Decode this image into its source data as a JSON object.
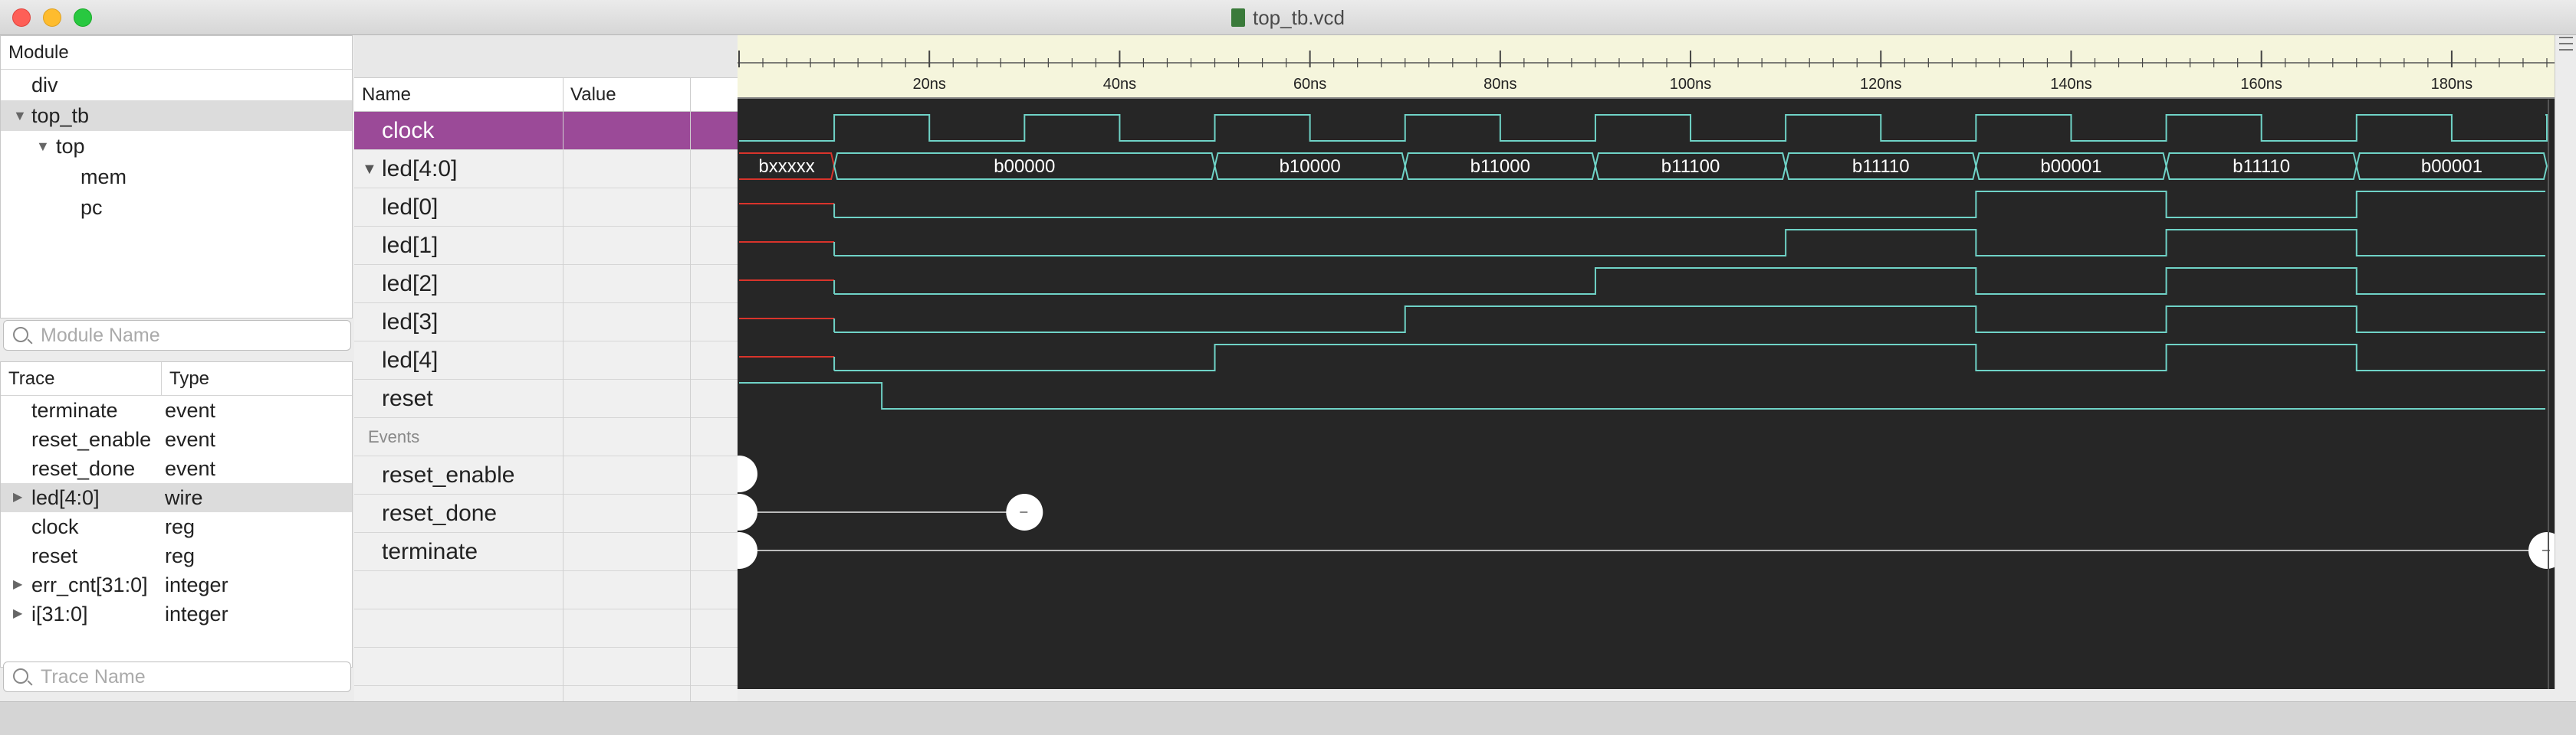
{
  "window": {
    "title": "top_tb.vcd"
  },
  "module_panel": {
    "header": "Module",
    "items": [
      {
        "label": "div",
        "indent": 0,
        "expand": "",
        "selected": false
      },
      {
        "label": "top_tb",
        "indent": 0,
        "expand": "▼",
        "selected": true
      },
      {
        "label": "top",
        "indent": 1,
        "expand": "▼",
        "selected": false
      },
      {
        "label": "mem",
        "indent": 2,
        "expand": "",
        "selected": false
      },
      {
        "label": "pc",
        "indent": 2,
        "expand": "",
        "selected": false
      }
    ],
    "search_placeholder": "Module Name"
  },
  "trace_panel": {
    "col_trace": "Trace",
    "col_type": "Type",
    "rows": [
      {
        "name": "terminate",
        "type": "event",
        "expand": "",
        "selected": false
      },
      {
        "name": "reset_enable",
        "type": "event",
        "expand": "",
        "selected": false
      },
      {
        "name": "reset_done",
        "type": "event",
        "expand": "",
        "selected": false
      },
      {
        "name": "led[4:0]",
        "type": "wire",
        "expand": "▶",
        "selected": true
      },
      {
        "name": "clock",
        "type": "reg",
        "expand": "",
        "selected": false
      },
      {
        "name": "reset",
        "type": "reg",
        "expand": "",
        "selected": false
      },
      {
        "name": "err_cnt[31:0]",
        "type": "integer",
        "expand": "▶",
        "selected": false
      },
      {
        "name": "i[31:0]",
        "type": "integer",
        "expand": "▶",
        "selected": false
      }
    ],
    "search_placeholder": "Trace Name"
  },
  "signal_panel": {
    "col_name": "Name",
    "col_value": "Value",
    "rows": [
      {
        "name": "clock",
        "kind": "signal",
        "selected": true,
        "expand": ""
      },
      {
        "name": "led[4:0]",
        "kind": "signal",
        "selected": false,
        "expand": "▼"
      },
      {
        "name": "led[0]",
        "kind": "signal",
        "selected": false,
        "expand": ""
      },
      {
        "name": "led[1]",
        "kind": "signal",
        "selected": false,
        "expand": ""
      },
      {
        "name": "led[2]",
        "kind": "signal",
        "selected": false,
        "expand": ""
      },
      {
        "name": "led[3]",
        "kind": "signal",
        "selected": false,
        "expand": ""
      },
      {
        "name": "led[4]",
        "kind": "signal",
        "selected": false,
        "expand": ""
      },
      {
        "name": "reset",
        "kind": "signal",
        "selected": false,
        "expand": ""
      },
      {
        "name": "Events",
        "kind": "group",
        "selected": false,
        "expand": ""
      },
      {
        "name": "reset_enable",
        "kind": "signal",
        "selected": false,
        "expand": ""
      },
      {
        "name": "reset_done",
        "kind": "signal",
        "selected": false,
        "expand": ""
      },
      {
        "name": "terminate",
        "kind": "signal",
        "selected": false,
        "expand": ""
      },
      {
        "name": "",
        "kind": "empty",
        "selected": false,
        "expand": ""
      },
      {
        "name": "",
        "kind": "empty",
        "selected": false,
        "expand": ""
      },
      {
        "name": "",
        "kind": "empty",
        "selected": false,
        "expand": ""
      }
    ]
  },
  "waveform": {
    "time_unit": "ns",
    "time_end": 190,
    "ruler_labels": [
      "20ns",
      "40ns",
      "60ns",
      "80ns",
      "100ns",
      "120ns",
      "140ns",
      "160ns",
      "180ns"
    ],
    "clock_edges": [
      10,
      20,
      30,
      40,
      50,
      60,
      70,
      80,
      90,
      100,
      110,
      120,
      130,
      140,
      150,
      160,
      170,
      180,
      190
    ],
    "bus_segments": [
      {
        "start": 0,
        "end": 10,
        "label": "bxxxxx",
        "unknown": true
      },
      {
        "start": 10,
        "end": 50,
        "label": "b00000"
      },
      {
        "start": 50,
        "end": 70,
        "label": "b10000"
      },
      {
        "start": 70,
        "end": 90,
        "label": "b11000"
      },
      {
        "start": 90,
        "end": 110,
        "label": "b11100"
      },
      {
        "start": 110,
        "end": 130,
        "label": "b11110"
      },
      {
        "start": 130,
        "end": 150,
        "label": "b00001"
      },
      {
        "start": 150,
        "end": 170,
        "label": "b11110"
      },
      {
        "start": 170,
        "end": 190,
        "label": "b00001"
      }
    ],
    "bits": [
      {
        "name": "led[0]",
        "transitions": [
          [
            10,
            0
          ],
          [
            130,
            1
          ],
          [
            150,
            0
          ],
          [
            170,
            1
          ]
        ]
      },
      {
        "name": "led[1]",
        "transitions": [
          [
            10,
            0
          ],
          [
            110,
            1
          ],
          [
            130,
            0
          ],
          [
            150,
            1
          ],
          [
            170,
            0
          ]
        ]
      },
      {
        "name": "led[2]",
        "transitions": [
          [
            10,
            0
          ],
          [
            90,
            1
          ],
          [
            130,
            0
          ],
          [
            150,
            1
          ],
          [
            170,
            0
          ]
        ]
      },
      {
        "name": "led[3]",
        "transitions": [
          [
            10,
            0
          ],
          [
            70,
            1
          ],
          [
            130,
            0
          ],
          [
            150,
            1
          ],
          [
            170,
            0
          ]
        ]
      },
      {
        "name": "led[4]",
        "transitions": [
          [
            10,
            0
          ],
          [
            50,
            1
          ],
          [
            130,
            0
          ],
          [
            150,
            1
          ],
          [
            170,
            0
          ]
        ]
      }
    ],
    "reset_fall": 15,
    "events": [
      {
        "name": "reset_enable",
        "times": [
          0
        ]
      },
      {
        "name": "reset_done",
        "times": [
          0,
          30
        ]
      },
      {
        "name": "terminate",
        "times": [
          0,
          190
        ]
      }
    ]
  },
  "colors": {
    "accent": "#9b4a98",
    "wave": "#6fd3c7",
    "unknown": "#d9342b",
    "wave_bg": "#262626",
    "ruler_bg": "#f5f5dc"
  }
}
